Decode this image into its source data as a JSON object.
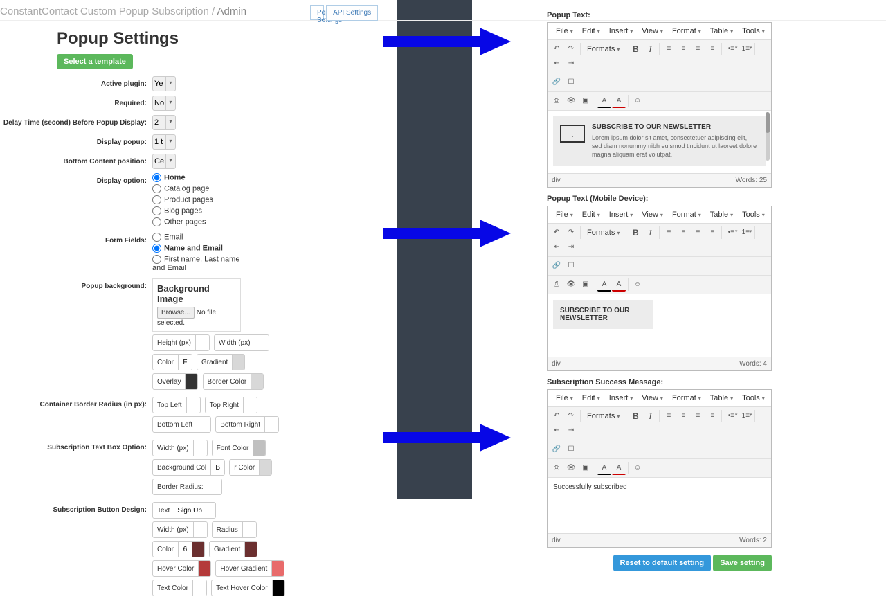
{
  "breadcrumb": {
    "path": "ConstantContact Custom Popup Subscription /",
    "page": "Admin"
  },
  "nav": {
    "popup": "Popup Settings",
    "api": "API Settings"
  },
  "title": "Popup Settings",
  "select_template": "Select a template",
  "labels": {
    "active": "Active plugin:",
    "required": "Required:",
    "delay": "Delay Time (second) Before Popup Display:",
    "display_popup": "Display popup:",
    "bottom_pos": "Bottom Content position:",
    "display_option": "Display option:",
    "form_fields": "Form Fields:",
    "popup_bg": "Popup background:",
    "border_radius": "Container Border Radius (in px):",
    "textbox": "Subscription Text Box Option:",
    "button": "Subscription Button Design:"
  },
  "vals": {
    "active": "Ye",
    "required": "No",
    "delay": "2",
    "display_popup": "1 t",
    "bottom_pos": "Ce"
  },
  "display_option": [
    "Home",
    "Catalog page",
    "Product pages",
    "Blog pages",
    "Other pages"
  ],
  "display_option_selected": 0,
  "form_fields": [
    "Email",
    "Name and Email",
    "First name, Last name and Email"
  ],
  "form_fields_selected": 1,
  "bg": {
    "title": "Background Image",
    "browse": "Browse...",
    "nofile": "No file selected.",
    "height": "Height (px)",
    "width": "Width (px)",
    "color": "Color",
    "color_v": "F",
    "gradient": "Gradient",
    "overlay": "Overlay",
    "overlay_c": "#333333",
    "border_color": "Border Color",
    "border_c": "#d8d8d8"
  },
  "radius": {
    "tl": "Top Left",
    "tr": "Top Right",
    "bl": "Bottom Left",
    "br": "Bottom Right"
  },
  "textbox": {
    "width": "Width (px)",
    "font_color": "Font Color",
    "font_c": "#c0c0c0",
    "bg": "Background Col",
    "bg_v": "B",
    "bcolor": "r Color",
    "bc": "#d8d8d8",
    "bradius": "Border Radius:"
  },
  "btn": {
    "text_l": "Text",
    "text_v": "Sign Up",
    "width": "Width (px)",
    "radius": "Radius",
    "color": "Color",
    "color_v": "6",
    "color_c": "#6b2f2f",
    "gradient": "Gradient",
    "grad_c": "#6b2f2f",
    "hcolor": "Hover Color",
    "hc_c": "#b43a3a",
    "hgrad": "Hover Gradient",
    "hg_c": "#e86b6b",
    "tcolor": "Text Color",
    "thcolor": "Text Hover Color",
    "th_c": "#000000"
  },
  "editor_menus": [
    "File",
    "Edit",
    "Insert",
    "View",
    "Format",
    "Table",
    "Tools"
  ],
  "formats": "Formats",
  "labels_right": {
    "popup_text": "Popup Text:",
    "mobile": "Popup Text (Mobile Device):",
    "succ": "Subscription Success Message:"
  },
  "content1": {
    "h": "SUBSCRIBE TO OUR NEWSLETTER",
    "p": "Lorem ipsum dolor sit amet, consectetuer adipiscing elit, sed diam nonummy nibh euismod tincidunt ut laoreet dolore magna aliquam erat volutpat.",
    "tag": "div",
    "words": "Words: 25"
  },
  "content2": {
    "h": "SUBSCRIBE TO OUR NEWSLETTER",
    "tag": "div",
    "words": "Words: 4"
  },
  "content3": {
    "txt": "Successfully subscribed",
    "tag": "div",
    "words": "Words: 2"
  },
  "foot": {
    "reset": "Reset to default setting",
    "save": "Save setting"
  }
}
